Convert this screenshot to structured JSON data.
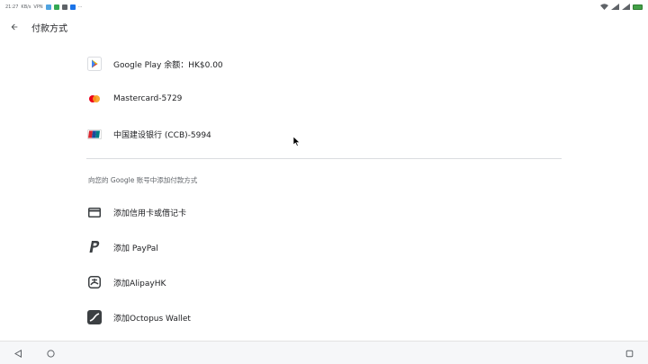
{
  "status_bar": {
    "time": "21:27",
    "net_speed": "KB/s",
    "vpn": "VPN",
    "battery_color": "#43a047"
  },
  "app_bar": {
    "title": "付款方式",
    "back_icon": "arrow-left-icon"
  },
  "payment_methods": [
    {
      "label": "Google Play 余额：HK$0.00",
      "icon": "google-play-icon"
    },
    {
      "label": "Mastercard-5729",
      "icon": "mastercard-icon"
    },
    {
      "label": "中国建设银行 (CCB)-5994",
      "icon": "unionpay-icon"
    }
  ],
  "add_section": {
    "header": "向您的 Google 账号中添加付款方式",
    "items": [
      {
        "label": "添加信用卡或借记卡",
        "icon": "credit-card-icon"
      },
      {
        "label": "添加 PayPal",
        "icon": "paypal-icon"
      },
      {
        "label": "添加AlipayHK",
        "icon": "alipay-icon"
      },
      {
        "label": "添加Octopus Wallet",
        "icon": "octopus-icon"
      }
    ]
  },
  "nav_bar": {
    "back": "nav-back-icon",
    "home": "nav-home-icon",
    "recents": "nav-recents-icon"
  }
}
